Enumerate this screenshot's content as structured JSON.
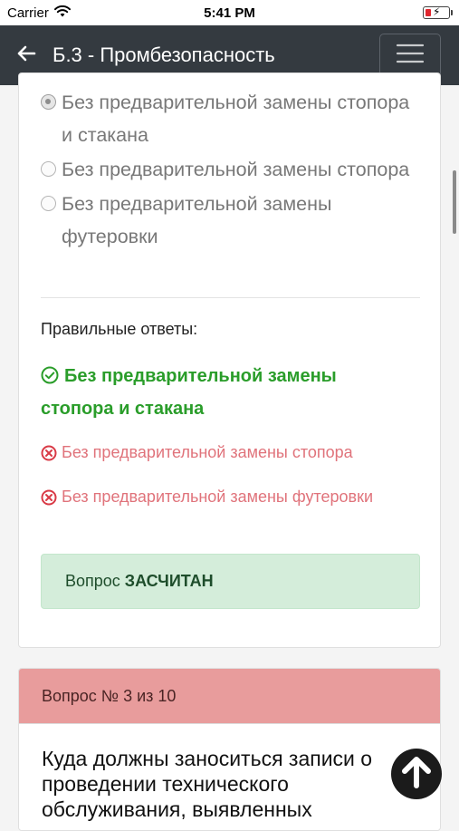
{
  "status_bar": {
    "carrier": "Carrier",
    "time": "5:41 PM"
  },
  "navbar": {
    "title": "Б.3 - Промбезопасность"
  },
  "options": [
    {
      "text": "Без предварительной замены стопора и стакана",
      "selected": true
    },
    {
      "text": "Без предварительной замены стопора",
      "selected": false
    },
    {
      "text": "Без предварительной замены футеровки",
      "selected": false
    }
  ],
  "answers": {
    "heading": "Правильные ответы:",
    "correct": "Без предварительной замены стопора и стакана",
    "wrong": [
      "Без предварительной замены стопора",
      "Без предварительной замены футеровки"
    ]
  },
  "result": {
    "prefix": "Вопрос",
    "status": "ЗАСЧИТАН"
  },
  "next_question": {
    "header": "Вопрос № 3 из 10",
    "text": "Куда должны заноситься записи о проведении технического обслуживания, выявленных"
  },
  "colors": {
    "navbar": "#343a40",
    "correct": "#2a9d2a",
    "wrong": "#e0737b",
    "success_bg": "#d4edda",
    "question_header_bg": "#e89c9c"
  },
  "icons": {
    "back": "arrow-left-icon",
    "menu": "hamburger-icon",
    "correct": "check-circle-icon",
    "wrong": "x-circle-icon",
    "scroll_top": "arrow-up-icon"
  }
}
